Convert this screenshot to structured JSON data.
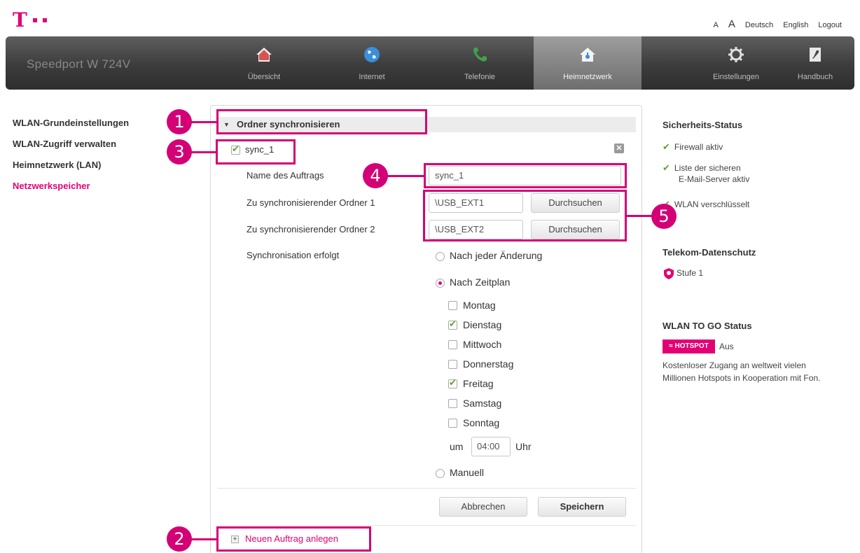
{
  "brand": {
    "name": "Speedport W 724V"
  },
  "toplinks": {
    "font_small": "A",
    "font_large": "A",
    "lang_de": "Deutsch",
    "lang_en": "English",
    "logout": "Logout"
  },
  "nav": [
    {
      "label": "Übersicht",
      "icon": "home-icon"
    },
    {
      "label": "Internet",
      "icon": "globe-icon"
    },
    {
      "label": "Telefonie",
      "icon": "phone-icon"
    },
    {
      "label": "Heimnetzwerk",
      "icon": "network-home-icon",
      "active": true
    },
    {
      "label": "Einstellungen",
      "icon": "gear-icon"
    },
    {
      "label": "Handbuch",
      "icon": "manual-icon"
    }
  ],
  "sidebar": [
    {
      "label": "WLAN-Grundeinstellungen"
    },
    {
      "label": "WLAN-Zugriff verwalten"
    },
    {
      "label": "Heimnetzwerk (LAN)"
    },
    {
      "label": "Netzwerkspeicher",
      "active": true
    }
  ],
  "section": {
    "title": "Ordner synchronisieren"
  },
  "job": {
    "name": "sync_1",
    "name_label": "Name des Auftrags",
    "name_value": "sync_1",
    "folder1_label": "Zu synchronisierender Ordner 1",
    "folder1_value": "\\USB_EXT1",
    "folder2_label": "Zu synchronisierender Ordner 2",
    "folder2_value": "\\USB_EXT2",
    "browse_label": "Durchsuchen",
    "sync_label": "Synchronisation erfolgt",
    "opt_change": "Nach jeder Änderung",
    "opt_schedule": "Nach Zeitplan",
    "opt_manual": "Manuell",
    "days": [
      {
        "label": "Montag",
        "checked": false
      },
      {
        "label": "Dienstag",
        "checked": true
      },
      {
        "label": "Mittwoch",
        "checked": false
      },
      {
        "label": "Donnerstag",
        "checked": false
      },
      {
        "label": "Freitag",
        "checked": true
      },
      {
        "label": "Samstag",
        "checked": false
      },
      {
        "label": "Sonntag",
        "checked": false
      }
    ],
    "time_prefix": "um",
    "time_value": "04:00",
    "time_suffix": "Uhr",
    "cancel_label": "Abbrechen",
    "save_label": "Speichern",
    "new_job_label": "Neuen Auftrag anlegen"
  },
  "status": {
    "security_title": "Sicherheits-Status",
    "firewall": "Firewall aktiv",
    "mail_1": "Liste der sicheren",
    "mail_2": "E-Mail-Server aktiv",
    "wlan": "WLAN verschlüsselt",
    "privacy_title": "Telekom-Datenschutz",
    "privacy_level": "Stufe 1",
    "wlantogo_title": "WLAN TO GO Status",
    "hotspot_badge": "HOTSPOT",
    "hotspot_state": "Aus",
    "hotspot_desc_1": "Kostenloser Zugang an weltweit vielen",
    "hotspot_desc_2": "Millionen Hotspots in Kooperation mit Fon."
  },
  "callouts": [
    "1",
    "2",
    "3",
    "4",
    "5"
  ],
  "colors": {
    "accent": "#e20074",
    "callout": "#d40075",
    "check": "#5da130"
  }
}
